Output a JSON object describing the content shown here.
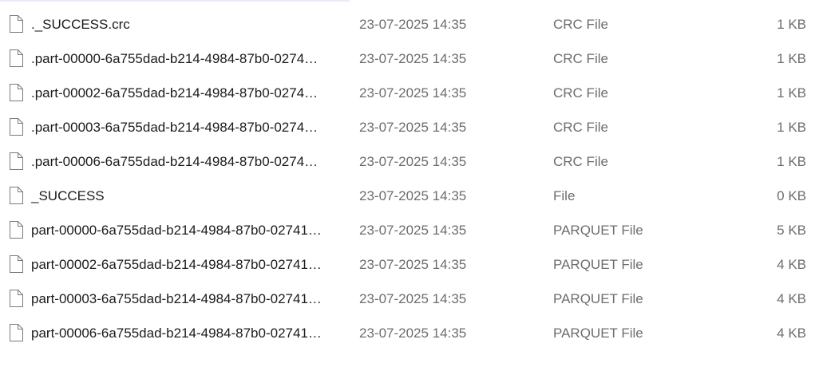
{
  "colors": {
    "name_text": "#1b1b1b",
    "meta_text": "#6d6d6d",
    "icon_stroke": "#7a7a7a",
    "row_hover": "#e5f3ff"
  },
  "files": [
    {
      "name": "._SUCCESS.crc",
      "date": "23-07-2025 14:35",
      "type": "CRC File",
      "size": "1 KB",
      "icon": "file-icon"
    },
    {
      "name": ".part-00000-6a755dad-b214-4984-87b0-0274…",
      "date": "23-07-2025 14:35",
      "type": "CRC File",
      "size": "1 KB",
      "icon": "file-icon"
    },
    {
      "name": ".part-00002-6a755dad-b214-4984-87b0-0274…",
      "date": "23-07-2025 14:35",
      "type": "CRC File",
      "size": "1 KB",
      "icon": "file-icon"
    },
    {
      "name": ".part-00003-6a755dad-b214-4984-87b0-0274…",
      "date": "23-07-2025 14:35",
      "type": "CRC File",
      "size": "1 KB",
      "icon": "file-icon"
    },
    {
      "name": ".part-00006-6a755dad-b214-4984-87b0-0274…",
      "date": "23-07-2025 14:35",
      "type": "CRC File",
      "size": "1 KB",
      "icon": "file-icon"
    },
    {
      "name": "_SUCCESS",
      "date": "23-07-2025 14:35",
      "type": "File",
      "size": "0 KB",
      "icon": "file-icon"
    },
    {
      "name": "part-00000-6a755dad-b214-4984-87b0-02741…",
      "date": "23-07-2025 14:35",
      "type": "PARQUET File",
      "size": "5 KB",
      "icon": "file-icon"
    },
    {
      "name": "part-00002-6a755dad-b214-4984-87b0-02741…",
      "date": "23-07-2025 14:35",
      "type": "PARQUET File",
      "size": "4 KB",
      "icon": "file-icon"
    },
    {
      "name": "part-00003-6a755dad-b214-4984-87b0-02741…",
      "date": "23-07-2025 14:35",
      "type": "PARQUET File",
      "size": "4 KB",
      "icon": "file-icon"
    },
    {
      "name": "part-00006-6a755dad-b214-4984-87b0-02741…",
      "date": "23-07-2025 14:35",
      "type": "PARQUET File",
      "size": "4 KB",
      "icon": "file-icon"
    }
  ]
}
